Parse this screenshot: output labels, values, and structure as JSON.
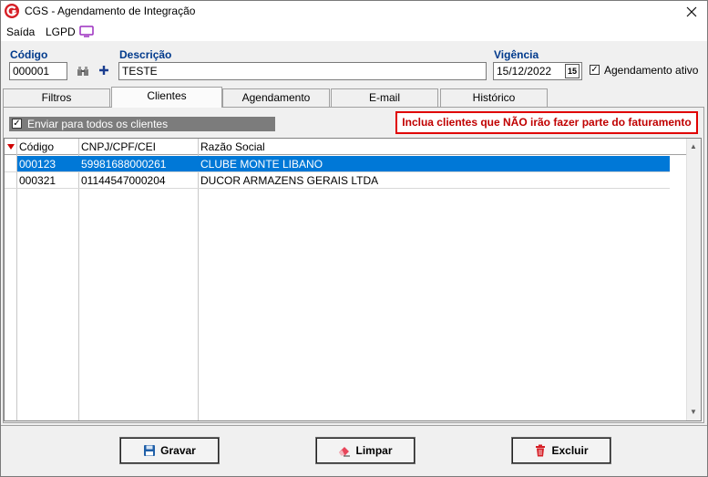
{
  "window": {
    "title": "CGS - Agendamento de Integração"
  },
  "menu": {
    "saida": "Saída",
    "lgpd": "LGPD"
  },
  "form": {
    "codigo_label": "Código",
    "codigo_value": "000001",
    "descricao_label": "Descrição",
    "descricao_value": "TESTE",
    "vigencia_label": "Vigência",
    "vigencia_value": "15/12/2022",
    "date_btn": "15",
    "agendamento_ativo_label": "Agendamento ativo",
    "agendamento_ativo_checked": true
  },
  "tabs": [
    {
      "label": "Filtros",
      "active": false
    },
    {
      "label": "Clientes",
      "active": true
    },
    {
      "label": "Agendamento",
      "active": false
    },
    {
      "label": "E-mail",
      "active": false
    },
    {
      "label": "Histórico",
      "active": false
    }
  ],
  "clientes": {
    "enviar_todos_label": "Enviar para todos os clientes",
    "enviar_todos_checked": true,
    "notice": "Inclua clientes que NÃO irão fazer parte do faturamento",
    "columns": [
      "Código",
      "CNPJ/CPF/CEI",
      "Razão Social"
    ],
    "rows": [
      {
        "codigo": "000123",
        "cnpj": "59981688000261",
        "razao": "CLUBE MONTE LIBANO",
        "selected": true
      },
      {
        "codigo": "000321",
        "cnpj": "01144547000204",
        "razao": "DUCOR ARMAZENS GERAIS LTDA",
        "selected": false
      }
    ]
  },
  "buttons": {
    "gravar": "Gravar",
    "limpar": "Limpar",
    "excluir": "Excluir"
  },
  "icons": {
    "app": "cgs-logo-icon",
    "lgpd": "monitor-icon",
    "search": "binoculars-icon",
    "add": "plus-icon",
    "gravar": "floppy-disk-icon",
    "limpar": "eraser-icon",
    "excluir": "trash-icon"
  },
  "colors": {
    "selection": "#0078d7",
    "notice_border": "#e00000",
    "notice_text": "#c00000",
    "label_blue": "#003a8c"
  }
}
